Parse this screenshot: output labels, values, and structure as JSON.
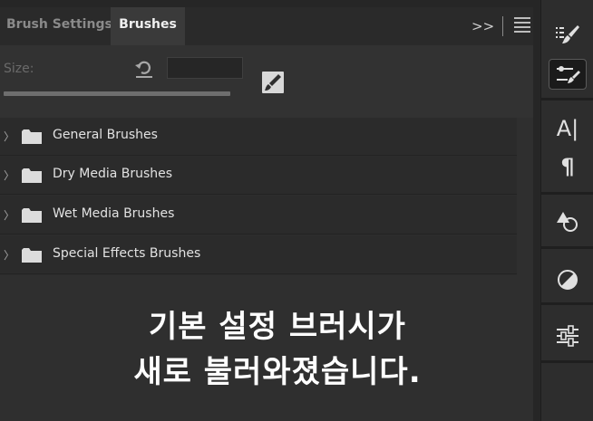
{
  "tabs": [
    {
      "label": "Brush Settings",
      "active": false
    },
    {
      "label": "Brushes",
      "active": true
    }
  ],
  "header": {
    "expand_glyph": ">>",
    "menu_icon": "hamburger-menu-icon"
  },
  "size": {
    "label": "Size:",
    "value": "",
    "reset_icon": "reset-arrow-icon",
    "new_brush_icon": "new-brush-icon"
  },
  "brush_folders": [
    {
      "label": "General Brushes"
    },
    {
      "label": "Dry Media Brushes"
    },
    {
      "label": "Wet Media Brushes"
    },
    {
      "label": "Special Effects Brushes"
    }
  ],
  "caption": {
    "line1": "기본 설정 브러시가",
    "line2": "새로 불러와졌습니다."
  },
  "toolbar": {
    "buttons": [
      {
        "icon": "brush-presets-icon",
        "active": false
      },
      {
        "icon": "brush-settings-icon",
        "active": true
      },
      {
        "icon": "character-icon",
        "glyph": "A|",
        "active": false
      },
      {
        "icon": "paragraph-icon",
        "glyph": "¶",
        "active": false
      },
      {
        "icon": "shapes-icon",
        "active": false
      },
      {
        "icon": "adjustments-icon",
        "active": false
      },
      {
        "icon": "properties-sliders-icon",
        "active": false
      }
    ]
  },
  "colors": {
    "panel_bg": "#323232",
    "tab_active": "#3a3a3a",
    "list_row": "#2b2b2b",
    "text": "#e2e2e2",
    "caption": "#ffffff"
  }
}
